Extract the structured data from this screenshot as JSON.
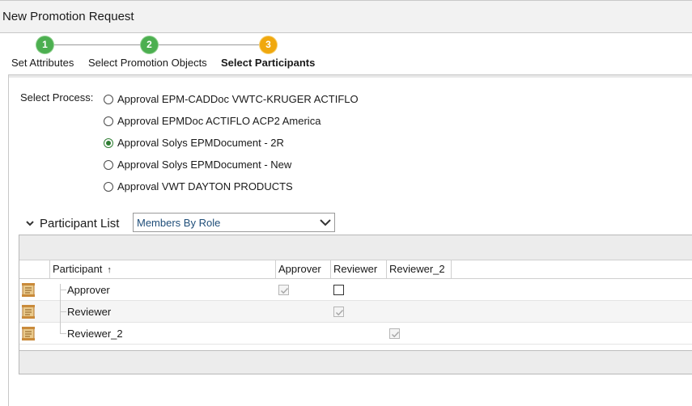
{
  "window": {
    "title": "New Promotion Request"
  },
  "wizard": {
    "steps": [
      {
        "number": "1",
        "label": "Set Attributes",
        "state": "done"
      },
      {
        "number": "2",
        "label": "Select Promotion Objects",
        "state": "done"
      },
      {
        "number": "3",
        "label": "Select Participants",
        "state": "current"
      }
    ]
  },
  "process": {
    "label": "Select Process:",
    "options": [
      {
        "label": "Approval EPM-CADDoc VWTC-KRUGER ACTIFLO",
        "selected": false
      },
      {
        "label": "Approval EPMDoc ACTIFLO ACP2 America",
        "selected": false
      },
      {
        "label": "Approval Solys EPMDocument - 2R",
        "selected": true
      },
      {
        "label": "Approval Solys EPMDocument - New",
        "selected": false
      },
      {
        "label": "Approval VWT DAYTON PRODUCTS",
        "selected": false
      }
    ]
  },
  "participant_list": {
    "title": "Participant List",
    "view_selected": "Members By Role",
    "columns": {
      "participant": "Participant",
      "sort_indicator": "↑",
      "approver": "Approver",
      "reviewer": "Reviewer",
      "reviewer_2": "Reviewer_2"
    },
    "rows": [
      {
        "name": "Approver",
        "approver": "checked-disabled",
        "reviewer": "unchecked",
        "reviewer_2": "none"
      },
      {
        "name": "Reviewer",
        "approver": "none",
        "reviewer": "checked-disabled",
        "reviewer_2": "none"
      },
      {
        "name": "Reviewer_2",
        "approver": "none",
        "reviewer": "none",
        "reviewer_2": "checked-disabled"
      }
    ]
  },
  "colors": {
    "step_done": "#4caf50",
    "step_current": "#f0a80e",
    "radio_selected": "#2e7d32",
    "dropdown_text": "#1f4e79"
  }
}
